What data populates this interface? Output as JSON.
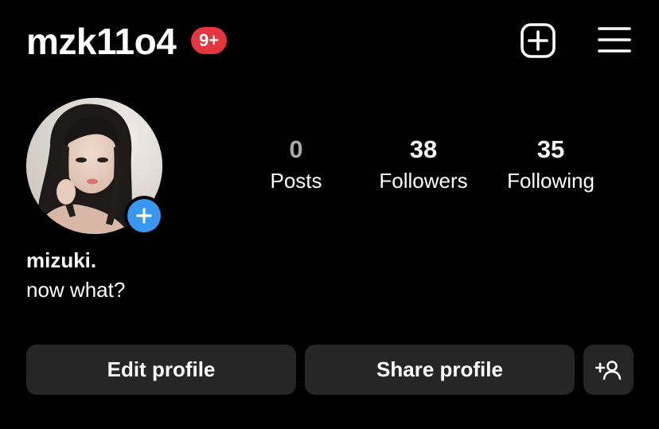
{
  "header": {
    "username": "mzk11o4",
    "notification_badge": "9+",
    "add_icon": "plus-square-icon",
    "menu_icon": "hamburger-menu-icon"
  },
  "profile": {
    "display_name": "mizuki.",
    "bio": "now what?",
    "avatar_add_icon": "plus-icon"
  },
  "stats": [
    {
      "value": "0",
      "label": "Posts"
    },
    {
      "value": "38",
      "label": "Followers"
    },
    {
      "value": "35",
      "label": "Following"
    }
  ],
  "actions": {
    "edit_label": "Edit profile",
    "share_label": "Share profile",
    "discover_icon": "add-person-icon"
  },
  "colors": {
    "background": "#000000",
    "badge": "#e4363f",
    "accent": "#3897f0",
    "button": "#262626"
  }
}
